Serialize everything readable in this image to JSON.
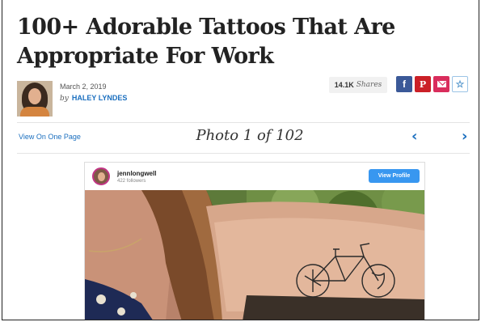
{
  "article": {
    "title": "100+ Adorable Tattoos That Are Appropriate For Work",
    "date": "March 2, 2019",
    "by": "by",
    "author": "HALEY LYNDES"
  },
  "share": {
    "count": "14.1K",
    "label": "Shares",
    "facebook_glyph": "f",
    "pinterest_glyph": "P",
    "favorite_glyph": "☆"
  },
  "gallery": {
    "view_on_one_page": "View On One Page",
    "photo_counter": "Photo 1 of 102",
    "prev_glyph": "‹",
    "next_glyph": "›"
  },
  "instagram": {
    "username": "jennlongwell",
    "followers": "422 followers",
    "view_profile": "View Profile"
  },
  "colors": {
    "link_blue": "#1b6fbf",
    "facebook": "#3b5998",
    "pinterest": "#cb2027",
    "email": "#d92d5c",
    "instagram_button": "#3897f0"
  },
  "icons": [
    "facebook-icon",
    "pinterest-icon",
    "email-icon",
    "star-icon",
    "chevron-left-icon",
    "chevron-right-icon"
  ]
}
